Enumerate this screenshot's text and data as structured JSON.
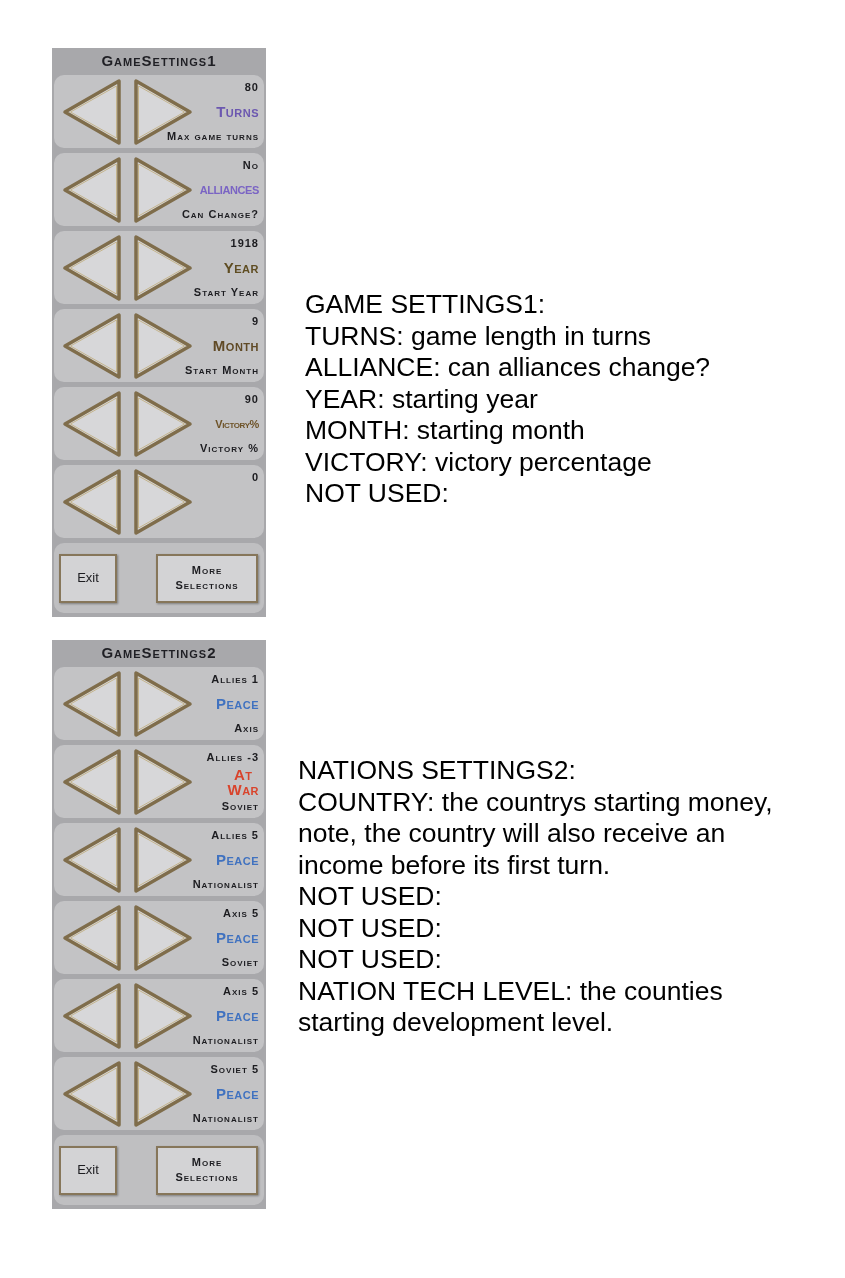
{
  "sections": [
    {
      "panel": {
        "title": "GameSettings1",
        "rows": [
          {
            "value": "80",
            "label": "Turns",
            "kind": "caps",
            "color": "#6b57b0",
            "description": "Max game turns"
          },
          {
            "value": "No",
            "label": "ALLIANCES",
            "kind": "condensed",
            "color": "#7a64c4",
            "description": "Can Change?"
          },
          {
            "value": "1918",
            "label": "Year",
            "kind": "caps",
            "color": "#5f4d22",
            "description": "Start Year"
          },
          {
            "value": "9",
            "label": "Month",
            "kind": "caps",
            "color": "#604a26",
            "description": "Start Month"
          },
          {
            "value": "90",
            "label": "Victory%",
            "kind": "condensed",
            "color": "#6e5328",
            "description": "Victory %"
          },
          {
            "value": "0"
          }
        ],
        "buttons": [
          {
            "label": "Exit",
            "kind": "plain"
          },
          {
            "label": "More Selections",
            "kind": "caps"
          }
        ]
      },
      "notes": [
        "GAME SETTINGS1:",
        "TURNS: game length in turns",
        "ALLIANCE: can alliances change?",
        "YEAR: starting year",
        "MONTH: starting month",
        "VICTORY: victory percentage",
        "NOT USED:"
      ]
    },
    {
      "panel": {
        "title": "GameSettings2",
        "rows": [
          {
            "value": "Allies 1",
            "label": "Peace",
            "kind": "caps",
            "color": "#4072c0",
            "description": "Axis"
          },
          {
            "value": "Allies -3",
            "label": "At War",
            "kind": "caps",
            "color": "#d9442c",
            "stacked": true,
            "description": "Soviet"
          },
          {
            "value": "Allies 5",
            "label": "Peace",
            "kind": "caps",
            "color": "#4072c0",
            "description": "Nationalist"
          },
          {
            "value": "Axis 5",
            "label": "Peace",
            "kind": "caps",
            "color": "#4072c0",
            "description": "Soviet"
          },
          {
            "value": "Axis 5",
            "label": "Peace",
            "kind": "caps",
            "color": "#4072c0",
            "description": "Nationalist"
          },
          {
            "value": "Soviet 5",
            "label": "Peace",
            "kind": "caps",
            "color": "#4072c0",
            "description": "Nationalist"
          }
        ],
        "buttons": [
          {
            "label": "Exit",
            "kind": "plain"
          },
          {
            "label": "More Selections",
            "kind": "caps"
          }
        ]
      },
      "notes": [
        "NATIONS SETTINGS2:",
        "COUNTRY: the countrys starting money, note, the country will also receive an income before its first turn.",
        "NOT USED:",
        "NOT USED:",
        "NOT USED:",
        "NATION TECH LEVEL: the counties starting development level."
      ]
    }
  ]
}
